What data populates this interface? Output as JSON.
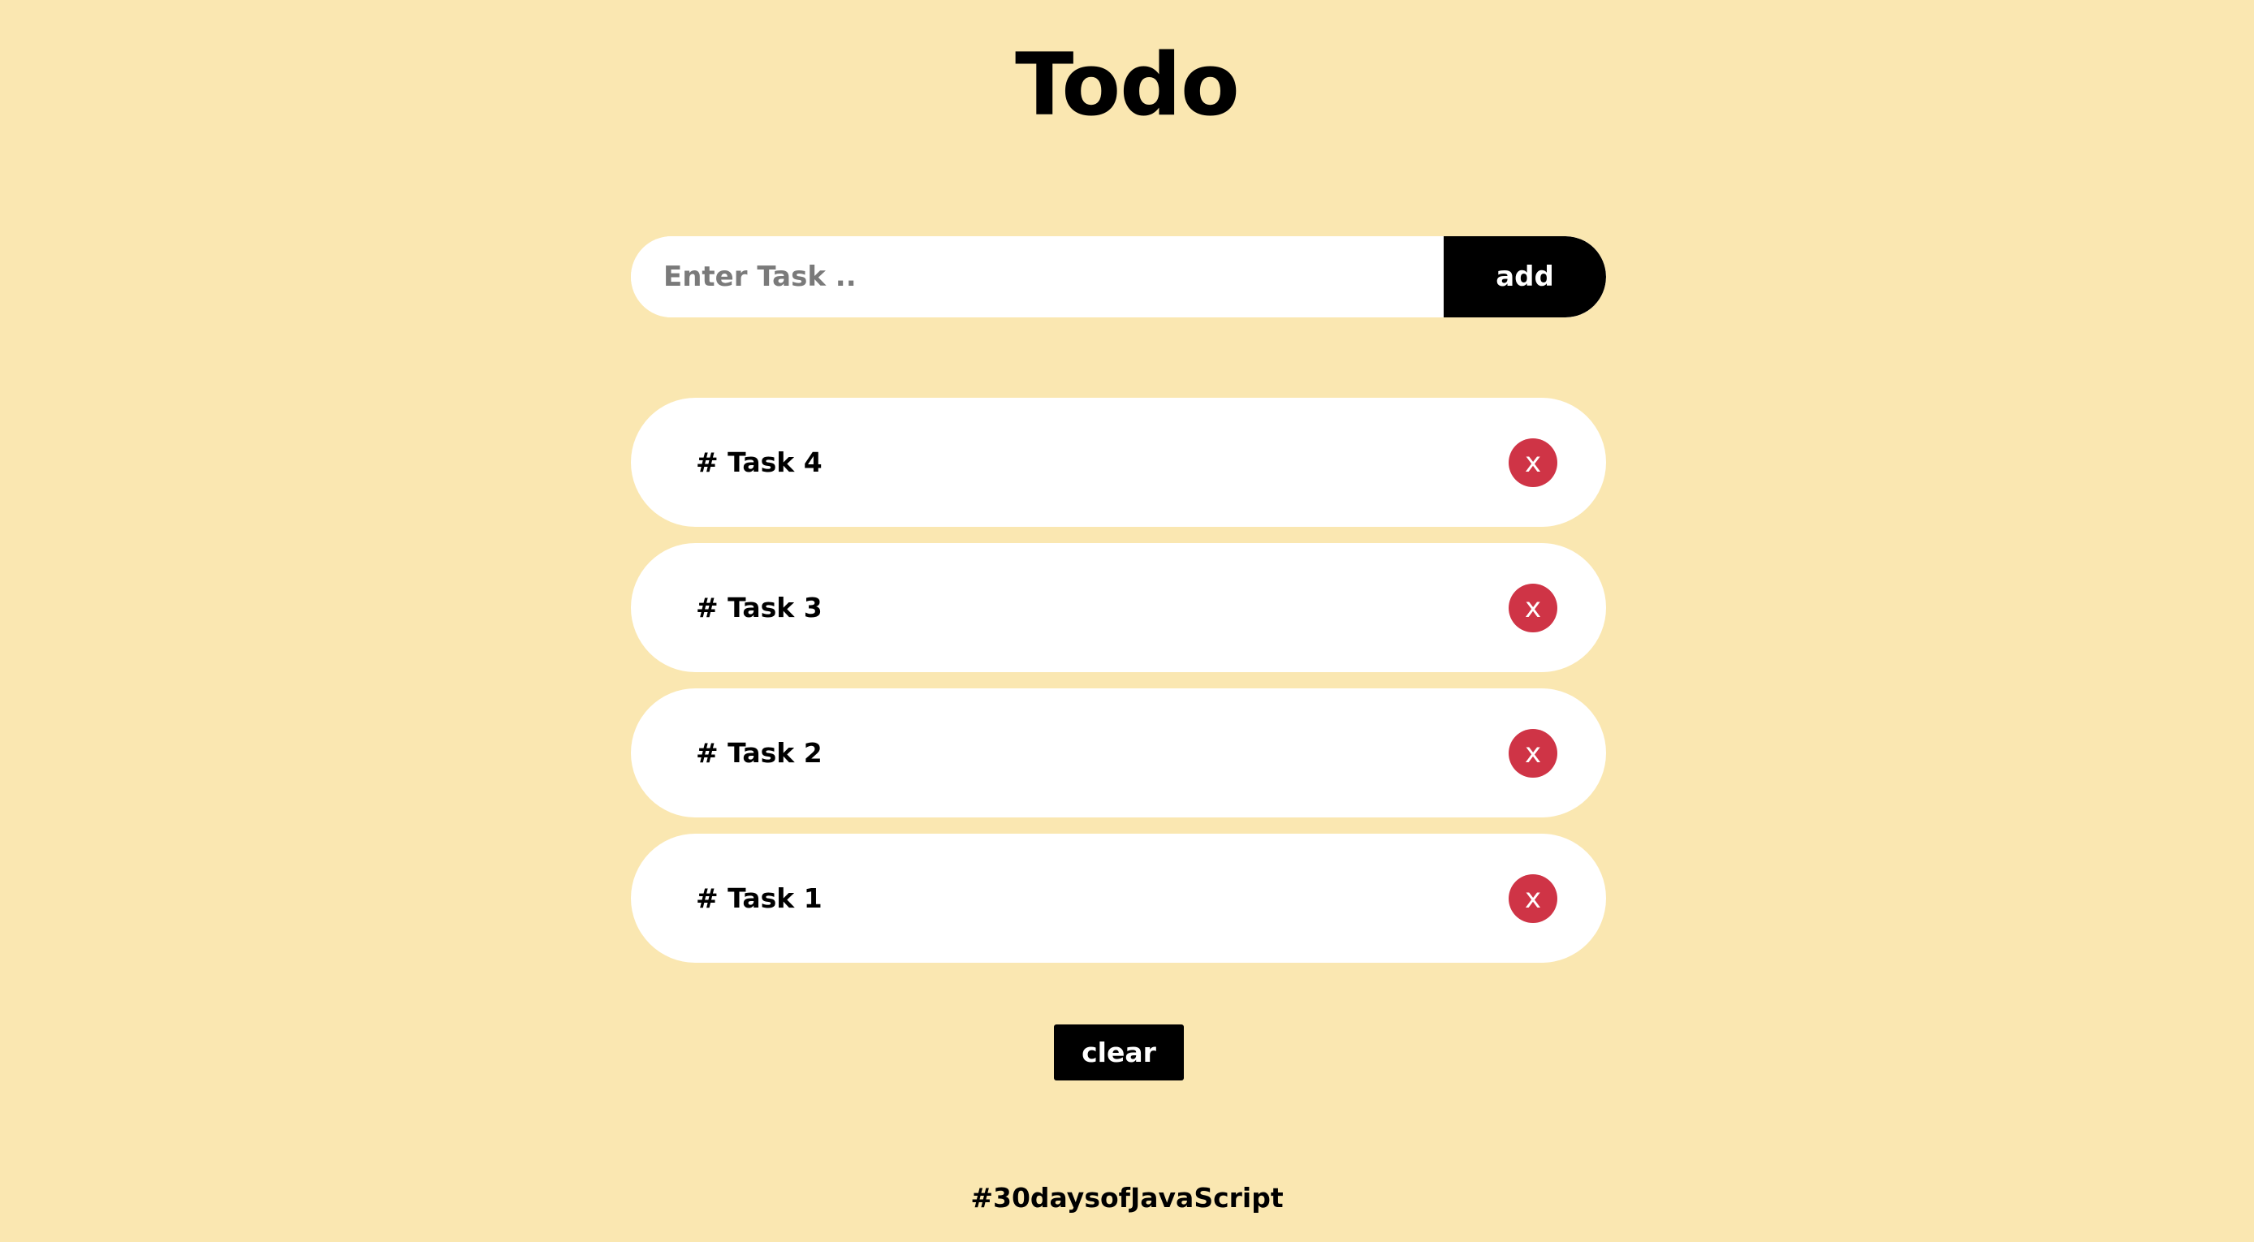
{
  "app": {
    "title": "Todo"
  },
  "add_bar": {
    "input_value": "",
    "input_placeholder": "Enter Task ..",
    "add_label": "add"
  },
  "tasks": [
    {
      "label": "# Task 4",
      "delete_label": "x"
    },
    {
      "label": "# Task 3",
      "delete_label": "x"
    },
    {
      "label": "# Task 2",
      "delete_label": "x"
    },
    {
      "label": "# Task 1",
      "delete_label": "x"
    }
  ],
  "clear_label": "clear",
  "footer": {
    "text": "#30daysofJavaScript"
  },
  "colors": {
    "background": "#fae7b1",
    "delete_button": "#cf3446",
    "primary_button": "#000000"
  }
}
